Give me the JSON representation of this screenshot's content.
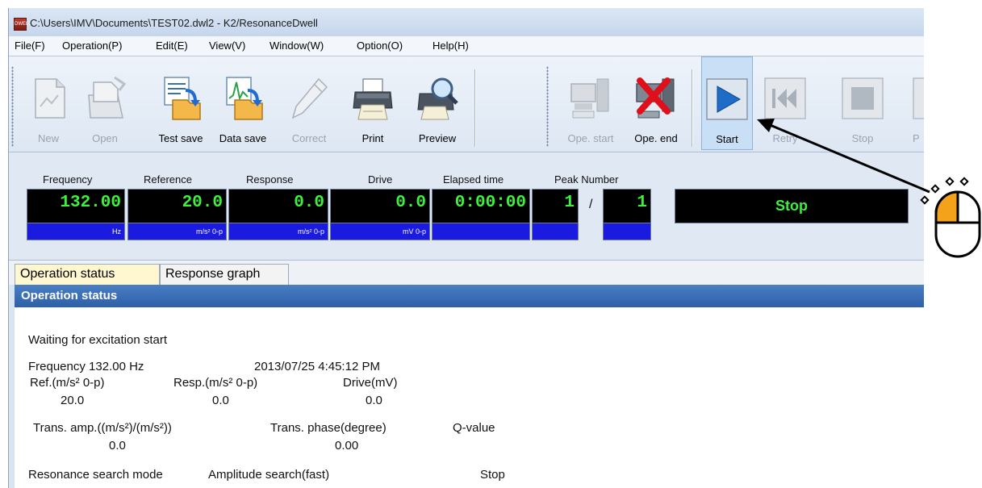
{
  "window": {
    "title": "C:\\Users\\IMV\\Documents\\TEST02.dwl2 - K2/ResonanceDwell",
    "app_icon_text": "DWELL"
  },
  "menu": [
    "File(F)",
    "Operation(P)",
    "Edit(E)",
    "View(V)",
    "Window(W)",
    "Option(O)",
    "Help(H)"
  ],
  "toolbar": {
    "buttons": [
      {
        "label": "New",
        "icon": "new-document-icon",
        "enabled": false
      },
      {
        "label": "Open",
        "icon": "open-folder-icon",
        "enabled": false
      },
      {
        "label": "Test save",
        "icon": "test-save-icon",
        "enabled": true
      },
      {
        "label": "Data save",
        "icon": "data-save-icon",
        "enabled": true
      },
      {
        "label": "Correct",
        "icon": "pencil-icon",
        "enabled": false
      },
      {
        "label": "Print",
        "icon": "printer-icon",
        "enabled": true
      },
      {
        "label": "Preview",
        "icon": "print-preview-icon",
        "enabled": true
      },
      {
        "label": "Ope. start",
        "icon": "operation-start-icon",
        "enabled": false
      },
      {
        "label": "Ope. end",
        "icon": "operation-end-icon",
        "enabled": true
      },
      {
        "label": "Start",
        "icon": "play-icon",
        "enabled": true
      },
      {
        "label": "Retry",
        "icon": "rewind-icon",
        "enabled": false
      },
      {
        "label": "Stop",
        "icon": "stop-icon",
        "enabled": false
      },
      {
        "label": "P",
        "icon": "partial-button-icon",
        "enabled": false
      }
    ]
  },
  "monitor": {
    "frequency": {
      "label": "Frequency",
      "value": "132.00",
      "unit": "Hz"
    },
    "reference": {
      "label": "Reference",
      "value": "20.0",
      "unit": "m/s² 0-p"
    },
    "response": {
      "label": "Response",
      "value": "0.0",
      "unit": "m/s² 0-p"
    },
    "drive": {
      "label": "Drive",
      "value": "0.0",
      "unit": "mV 0-p"
    },
    "elapsed": {
      "label": "Elapsed time",
      "value": "0:00:00",
      "unit": ""
    },
    "peak": {
      "label": "Peak Number",
      "current": "1",
      "separator": "/",
      "total": "1"
    },
    "state": "Stop"
  },
  "tabs": [
    {
      "label": "Operation status",
      "active": true
    },
    {
      "label": "Response graph",
      "active": false
    }
  ],
  "status": {
    "header": "Operation status",
    "message": "Waiting for excitation start",
    "frequency": "Frequency 132.00 Hz",
    "timestamp": "2013/07/25 4:45:12 PM",
    "ref_label": "Ref.(m/s² 0-p)",
    "resp_label": "Resp.(m/s² 0-p)",
    "drive_label": "Drive(mV)",
    "ref_value": "20.0",
    "resp_value": "0.0",
    "drive_value": "0.0",
    "trans_amp_label": "Trans. amp.((m/s²)/(m/s²))",
    "trans_phase_label": "Trans. phase(degree)",
    "q_label": "Q-value",
    "trans_amp_value": "0.0",
    "trans_phase_value": "0.00",
    "search_mode_label": "Resonance search mode",
    "search_mode_value": "Amplitude search(fast)",
    "search_state": "Stop"
  },
  "annotation": {
    "pointer": "mouse-left-click-icon",
    "highlight_color": "#f5a21b"
  },
  "colors": {
    "display_green": "#3df03d",
    "display_bg": "#000000",
    "unit_blue": "#1a1ae0",
    "header_blue": "#2d5fa7",
    "tab_active": "#fff7d0"
  }
}
